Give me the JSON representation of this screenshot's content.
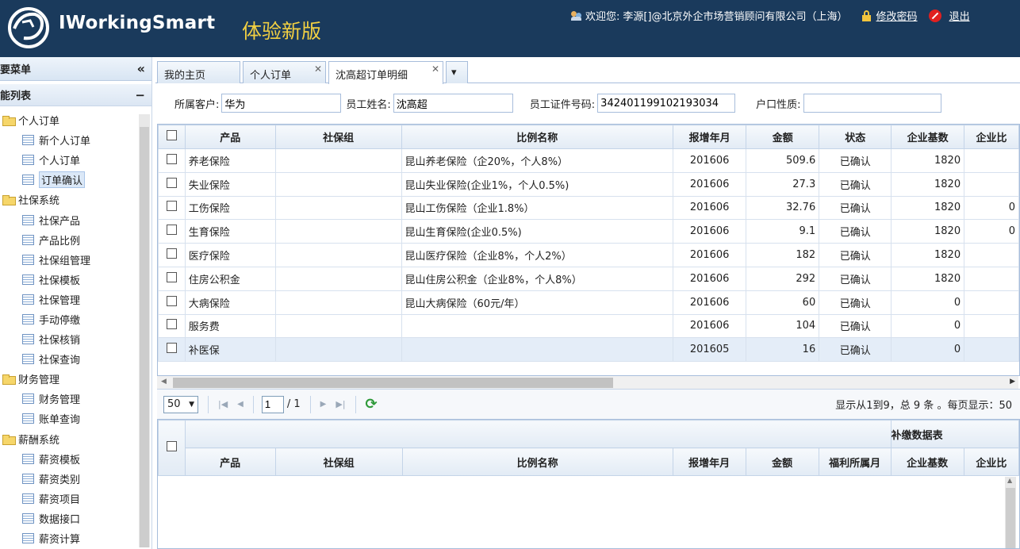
{
  "header": {
    "logo": "IWorkingSmart",
    "sub": "体验新版",
    "welcome": "欢迎您:",
    "user": "李源[]@北京外企市场营销顾问有限公司（上海）",
    "change_pwd": "修改密码",
    "logout": "退出"
  },
  "sidebar": {
    "title": "要菜单",
    "collapse": "«",
    "section": "能列表",
    "section_toggle": "−",
    "tree": [
      {
        "type": "folder",
        "label": "个人订单"
      },
      {
        "type": "leaf",
        "label": "新个人订单"
      },
      {
        "type": "leaf",
        "label": "个人订单"
      },
      {
        "type": "leaf",
        "label": "订单确认",
        "selected": true
      },
      {
        "type": "folder",
        "label": "社保系统"
      },
      {
        "type": "leaf",
        "label": "社保产品"
      },
      {
        "type": "leaf",
        "label": "产品比例"
      },
      {
        "type": "leaf",
        "label": "社保组管理"
      },
      {
        "type": "leaf",
        "label": "社保模板"
      },
      {
        "type": "leaf",
        "label": "社保管理"
      },
      {
        "type": "leaf",
        "label": "手动停缴"
      },
      {
        "type": "leaf",
        "label": "社保核销"
      },
      {
        "type": "leaf",
        "label": "社保查询"
      },
      {
        "type": "folder",
        "label": "财务管理"
      },
      {
        "type": "leaf",
        "label": "财务管理"
      },
      {
        "type": "leaf",
        "label": "账单查询"
      },
      {
        "type": "folder",
        "label": "薪酬系统"
      },
      {
        "type": "leaf",
        "label": "薪资模板"
      },
      {
        "type": "leaf",
        "label": "薪资类别"
      },
      {
        "type": "leaf",
        "label": "薪资项目"
      },
      {
        "type": "leaf",
        "label": "数据接口"
      },
      {
        "type": "leaf",
        "label": "薪资计算"
      }
    ]
  },
  "tabs": [
    {
      "label": "我的主页",
      "closable": false
    },
    {
      "label": "个人订单",
      "closable": true
    },
    {
      "label": "沈高超订单明细",
      "closable": true,
      "active": true
    }
  ],
  "tab_dropdown": "▾",
  "form": {
    "customer_label": "所属客户:",
    "customer": "华为",
    "name_label": "员工姓名:",
    "name": "沈高超",
    "id_label": "员工证件号码:",
    "id": "342401199102193034",
    "hukou_label": "户口性质:",
    "hukou": ""
  },
  "grid": {
    "columns": [
      "产品",
      "社保组",
      "比例名称",
      "报增年月",
      "金额",
      "状态",
      "企业基数",
      "企业比"
    ],
    "rows": [
      [
        "养老保险",
        "",
        "昆山养老保险（企20%，个人8%）",
        "201606",
        "509.6",
        "已确认",
        "1820",
        ""
      ],
      [
        "失业保险",
        "",
        "昆山失业保险(企业1%，个人0.5%)",
        "201606",
        "27.3",
        "已确认",
        "1820",
        ""
      ],
      [
        "工伤保险",
        "",
        "昆山工伤保险（企业1.8%）",
        "201606",
        "32.76",
        "已确认",
        "1820",
        "0"
      ],
      [
        "生育保险",
        "",
        "昆山生育保险(企业0.5%)",
        "201606",
        "9.1",
        "已确认",
        "1820",
        "0"
      ],
      [
        "医疗保险",
        "",
        "昆山医疗保险（企业8%，个人2%）",
        "201606",
        "182",
        "已确认",
        "1820",
        ""
      ],
      [
        "住房公积金",
        "",
        "昆山住房公积金（企业8%，个人8%）",
        "201606",
        "292",
        "已确认",
        "1820",
        ""
      ],
      [
        "大病保险",
        "",
        "昆山大病保险（60元/年）",
        "201606",
        "60",
        "已确认",
        "0",
        ""
      ],
      [
        "服务费",
        "",
        "",
        "201606",
        "104",
        "已确认",
        "0",
        ""
      ],
      [
        "补医保",
        "",
        "",
        "201605",
        "16",
        "已确认",
        "0",
        ""
      ]
    ]
  },
  "pager": {
    "page_size": "50",
    "page": "1",
    "total_pages": "/ 1",
    "summary": "显示从1到9，总 9 条 。每页显示：50"
  },
  "grid2": {
    "title": "补缴数据表",
    "columns": [
      "产品",
      "社保组",
      "比例名称",
      "报增年月",
      "金额",
      "福利所属月",
      "企业基数",
      "企业比"
    ]
  }
}
